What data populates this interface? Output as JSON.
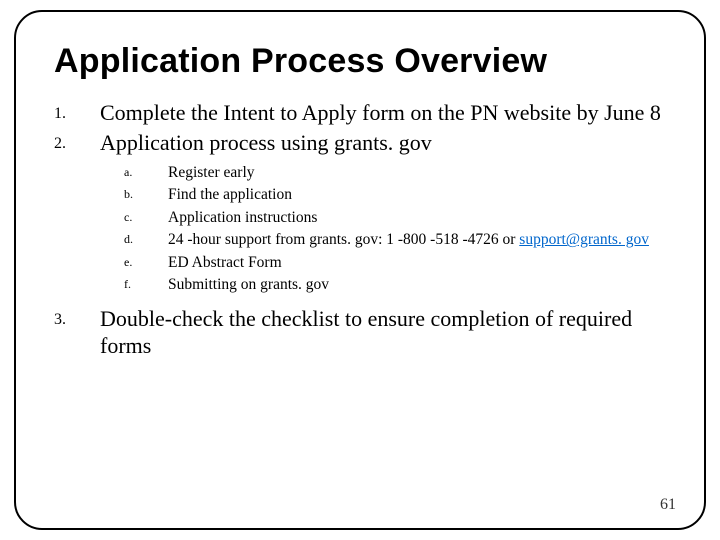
{
  "title": "Application Process Overview",
  "items": [
    {
      "marker": "1.",
      "text": "Complete the Intent to Apply form on the PN website by June 8"
    },
    {
      "marker": "2.",
      "text": "Application process using grants. gov"
    }
  ],
  "subitems": [
    {
      "marker": "a.",
      "text": "Register early"
    },
    {
      "marker": "b.",
      "text": "Find the application"
    },
    {
      "marker": "c.",
      "text": "Application instructions"
    },
    {
      "marker": "d.",
      "text_pre": "24 -hour support from grants. gov: 1 -800 -518 -4726 or ",
      "link": "support@grants. gov"
    },
    {
      "marker": "e.",
      "text": "ED Abstract Form"
    },
    {
      "marker": "f.",
      "text": "Submitting on grants. gov"
    }
  ],
  "item3": {
    "marker": "3.",
    "text": "Double-check the checklist to ensure completion of required forms"
  },
  "page_number": "61"
}
